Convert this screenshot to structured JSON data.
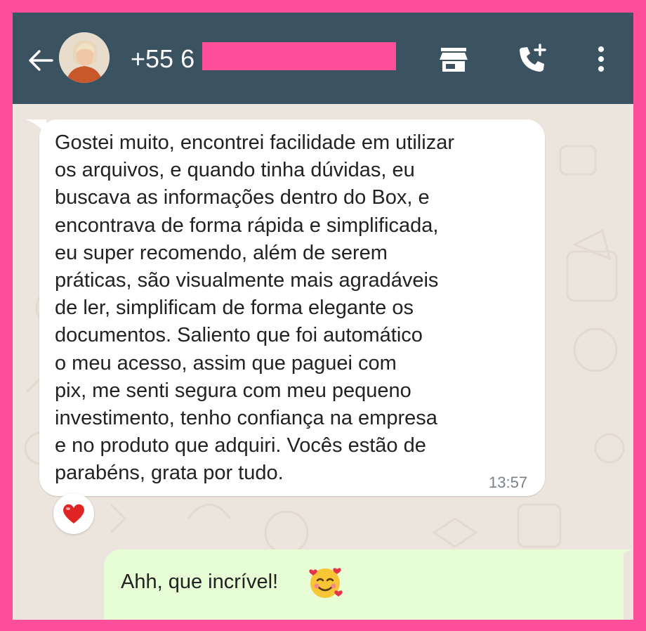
{
  "header": {
    "contact_name": "+55 6",
    "back_icon": "arrow-left-icon",
    "store_icon": "store-icon",
    "call_icon": "add-call-icon",
    "menu_icon": "more-vertical-icon",
    "bar_color": "#3b5360"
  },
  "messages": [
    {
      "direction": "incoming",
      "text": "Gostei muito, encontrei facilidade em utilizar\nos arquivos, e quando tinha dúvidas, eu\nbuscava as informações dentro do Box, e\nencontrava de forma rápida e simplificada,\neu super recomendo, além de serem\npráticas, são visualmente mais agradáveis\nde ler, simplificam de forma elegante os\ndocumentos. Saliento que foi automático\no meu acesso, assim que paguei com\npix, me senti segura com meu pequeno\ninvestimento, tenho confiança na empresa\ne no produto que adquiri. Vocês estão de\nparabéns, grata por tudo.",
      "time": "13:57",
      "reaction": "heart-emoji"
    },
    {
      "direction": "outgoing",
      "text": "Ahh, que incrível!",
      "emoji": "smiling-face-with-hearts-emoji"
    }
  ],
  "colors": {
    "frame_border": "#ff4f9a",
    "chat_background": "#ece5dd",
    "incoming_bubble": "#ffffff",
    "outgoing_bubble": "#e7fdd5"
  }
}
